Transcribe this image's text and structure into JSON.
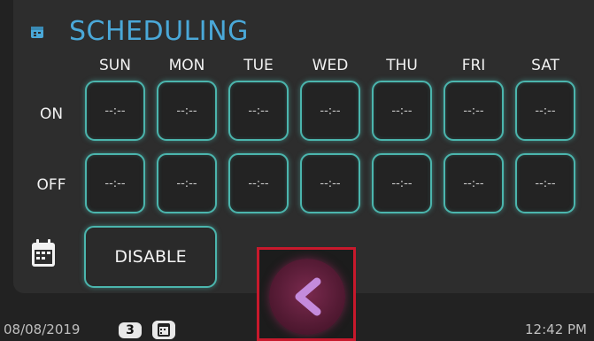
{
  "header": {
    "title": "SCHEDULING",
    "icon": "schedule-icon"
  },
  "days": [
    "SUN",
    "MON",
    "TUE",
    "WED",
    "THU",
    "FRI",
    "SAT"
  ],
  "rows": {
    "on": {
      "label": "ON",
      "times": [
        "--:--",
        "--:--",
        "--:--",
        "--:--",
        "--:--",
        "--:--",
        "--:--"
      ]
    },
    "off": {
      "label": "OFF",
      "times": [
        "--:--",
        "--:--",
        "--:--",
        "--:--",
        "--:--",
        "--:--",
        "--:--"
      ]
    }
  },
  "controls": {
    "calendar_icon": "calendar-icon",
    "disable_label": "DISABLE",
    "back_icon": "chevron-left-icon"
  },
  "status_bar": {
    "date": "08/08/2019",
    "badge_count": "3",
    "time": "12:42 PM"
  },
  "colors": {
    "accent": "#4aa8d8",
    "button_border": "#4bb5ad",
    "back_button": "#5a1a35",
    "highlight_frame": "#c8192c"
  }
}
